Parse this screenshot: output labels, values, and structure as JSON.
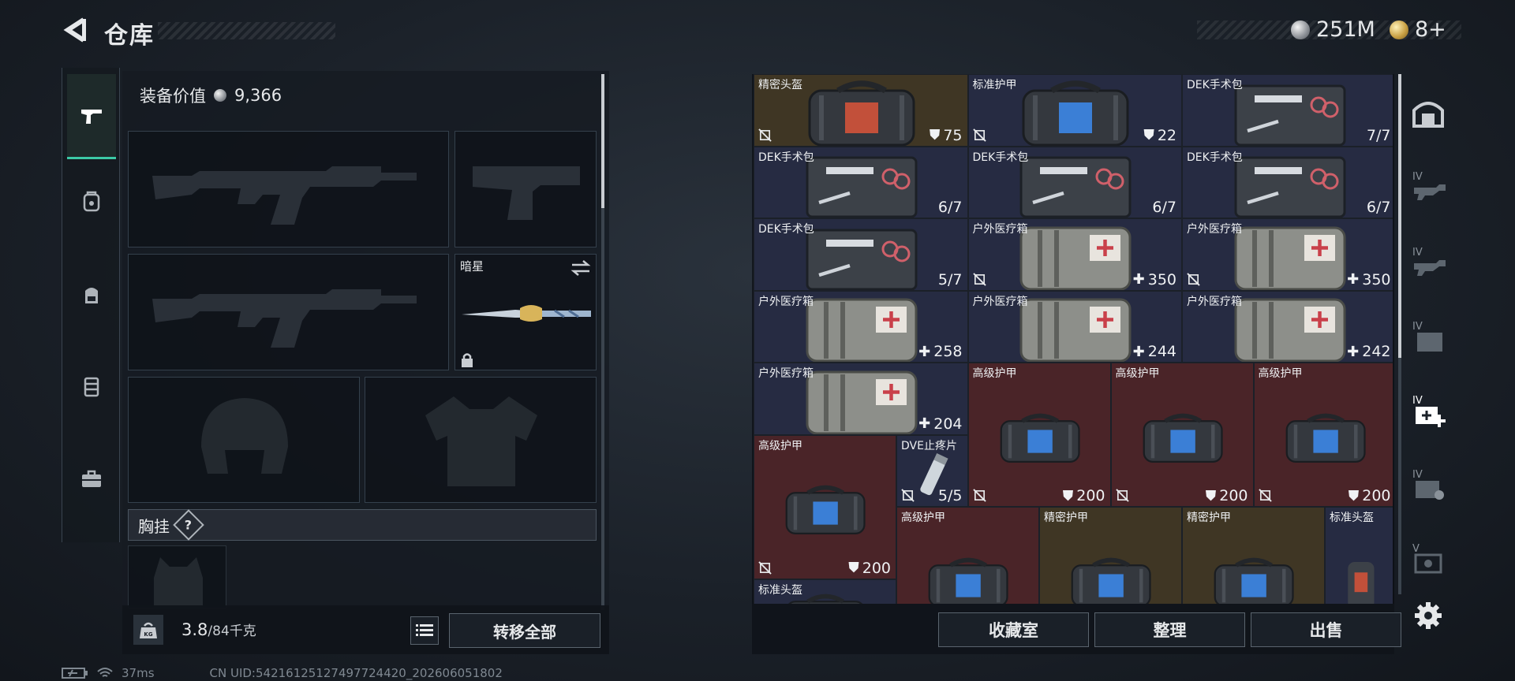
{
  "header": {
    "title": "仓库",
    "currency_silver": "251M",
    "currency_gold": "8+"
  },
  "loadout": {
    "equip_value_label": "装备价值",
    "equip_value": "9,366",
    "melee_slot_name": "暗星",
    "chest_rig_label": "胸挂",
    "chest_rig_help": "?",
    "weight_current": "3.8",
    "weight_capacity": "/84千克",
    "transfer_all_label": "转移全部"
  },
  "storage": {
    "items": [
      {
        "name": "精密头盔",
        "value": "75",
        "kind": "armor",
        "rarity": "gold",
        "icon": "helmet-bag"
      },
      {
        "name": "标准护甲",
        "value": "22",
        "kind": "armor",
        "rarity": "blue",
        "icon": "armor-bag"
      },
      {
        "name": "DEK手术包",
        "value": "7/7",
        "kind": "uses",
        "rarity": "blue",
        "icon": "surgery-kit"
      },
      {
        "name": "DEK手术包",
        "value": "6/7",
        "kind": "uses",
        "rarity": "blue",
        "icon": "surgery-kit"
      },
      {
        "name": "DEK手术包",
        "value": "6/7",
        "kind": "uses",
        "rarity": "blue",
        "icon": "surgery-kit"
      },
      {
        "name": "DEK手术包",
        "value": "6/7",
        "kind": "uses",
        "rarity": "blue",
        "icon": "surgery-kit"
      },
      {
        "name": "DEK手术包",
        "value": "5/7",
        "kind": "uses",
        "rarity": "blue",
        "icon": "surgery-kit"
      },
      {
        "name": "户外医疗箱",
        "value": "350",
        "kind": "heal",
        "rarity": "blue",
        "icon": "medical-case"
      },
      {
        "name": "户外医疗箱",
        "value": "350",
        "kind": "heal",
        "rarity": "blue",
        "icon": "medical-case"
      },
      {
        "name": "户外医疗箱",
        "value": "258",
        "kind": "heal",
        "rarity": "blue",
        "icon": "medical-case"
      },
      {
        "name": "户外医疗箱",
        "value": "244",
        "kind": "heal",
        "rarity": "blue",
        "icon": "medical-case"
      },
      {
        "name": "户外医疗箱",
        "value": "242",
        "kind": "heal",
        "rarity": "blue",
        "icon": "medical-case"
      },
      {
        "name": "户外医疗箱",
        "value": "204",
        "kind": "heal",
        "rarity": "blue",
        "icon": "medical-case"
      },
      {
        "name": "高级护甲",
        "value": "200",
        "kind": "armor",
        "rarity": "red",
        "icon": "armor-bag"
      },
      {
        "name": "高级护甲",
        "value": "200",
        "kind": "armor",
        "rarity": "red",
        "icon": "armor-bag"
      },
      {
        "name": "高级护甲",
        "value": "200",
        "kind": "armor",
        "rarity": "red",
        "icon": "armor-bag"
      },
      {
        "name": "高级护甲",
        "value": "200",
        "kind": "armor",
        "rarity": "red",
        "icon": "armor-bag"
      },
      {
        "name": "DVE止疼片",
        "value": "5/5",
        "kind": "uses",
        "rarity": "blue",
        "icon": "painkiller"
      },
      {
        "name": "高级护甲",
        "value": "",
        "kind": "armor",
        "rarity": "red",
        "icon": "armor-bag"
      },
      {
        "name": "精密护甲",
        "value": "",
        "kind": "armor",
        "rarity": "gold",
        "icon": "armor-bag"
      },
      {
        "name": "精密护甲",
        "value": "",
        "kind": "armor",
        "rarity": "gold",
        "icon": "armor-bag"
      },
      {
        "name": "标准头盔",
        "value": "",
        "kind": "armor",
        "rarity": "blue",
        "icon": "helmet"
      },
      {
        "name": "标准头盔",
        "value": "",
        "kind": "armor",
        "rarity": "blue",
        "icon": "helmet-bag"
      }
    ],
    "collection_label": "收藏室",
    "sort_label": "整理",
    "sell_label": "出售"
  },
  "status": {
    "ping": "37ms",
    "uid": "CN UID:54216125127497724420_202606051802"
  },
  "colors": {
    "accent": "#3cc9a6",
    "rarity_blue": "#262b42",
    "rarity_gold": "#3f3624",
    "rarity_red": "#4a2428"
  }
}
